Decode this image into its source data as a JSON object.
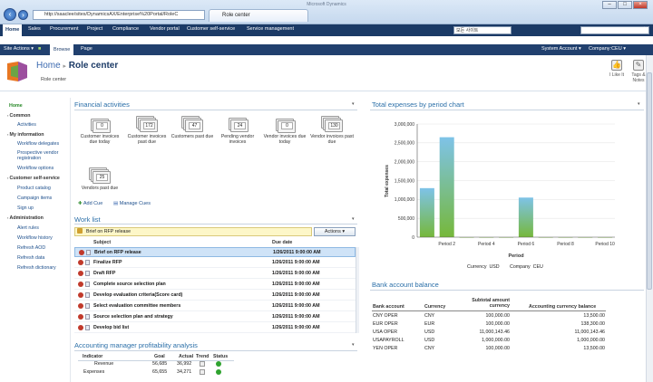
{
  "browser": {
    "window_title": "Microsoft Dynamics",
    "address": "http://saaclee/sites/DynamicsAX/Enterprise%20Portal/RoleC",
    "tab_title": "Role center"
  },
  "top_nav": {
    "items": [
      "Home",
      "Sales",
      "Procurement",
      "Project",
      "Compliance",
      "Vendor portal",
      "Customer self-service",
      "Service management"
    ],
    "search_scope": "모든 사이트"
  },
  "ribbon": {
    "site_actions": "Site Actions",
    "tabs": [
      "Browse",
      "Page"
    ],
    "account": "System Account",
    "company": "Company:CEU"
  },
  "header": {
    "home": "Home",
    "separator": "▸",
    "title": "Role center",
    "subtitle": "Role center",
    "like_label": "I Like It",
    "tags_label": "Tags & Notes"
  },
  "left_nav": {
    "home": "Home",
    "sections": [
      {
        "title": "Common",
        "items": [
          "Activities"
        ]
      },
      {
        "title": "My information",
        "items": [
          "Workflow delegates",
          "Prospective vendor registration",
          "Workflow options"
        ]
      },
      {
        "title": "Customer self-service",
        "items": [
          "Product catalog",
          "Campaign items",
          "Sign up"
        ]
      },
      {
        "title": "Administration",
        "items": [
          "Alert rules",
          "Workflow history",
          "Refresh AOD",
          "Refresh data",
          "Refresh dictionary"
        ]
      }
    ]
  },
  "financial_activities": {
    "title": "Financial activities",
    "cues": [
      {
        "label": "Customer invoices due today",
        "count": "0"
      },
      {
        "label": "Customer invoices past due",
        "count": "172"
      },
      {
        "label": "Customers past due",
        "count": "47"
      },
      {
        "label": "Pending vendor invoices",
        "count": "24"
      },
      {
        "label": "Vendor invoices due today",
        "count": "0"
      },
      {
        "label": "Vendor invoices past due",
        "count": "130"
      },
      {
        "label": "Vendors past due",
        "count": "25"
      }
    ],
    "add_cue": "Add Cue",
    "manage_cues": "Manage Cues"
  },
  "work_list": {
    "title": "Work list",
    "filter": "Brief on RFP release",
    "actions_label": "Actions",
    "columns": [
      "Subject",
      "Due date"
    ],
    "rows": [
      {
        "subject": "Brief on RFP release",
        "due": "1/26/2011 9:00:00 AM",
        "selected": true
      },
      {
        "subject": "Finalize RFP",
        "due": "1/26/2011 9:00:00 AM"
      },
      {
        "subject": "Draft RFP",
        "due": "1/26/2011 9:00:00 AM"
      },
      {
        "subject": "Complete source selection plan",
        "due": "1/26/2011 9:00:00 AM"
      },
      {
        "subject": "Develop evaluation criteria(Score card)",
        "due": "1/26/2011 9:00:00 AM"
      },
      {
        "subject": "Select evaluation committee members",
        "due": "1/26/2011 9:00:00 AM"
      },
      {
        "subject": "Source selection plan and strategy",
        "due": "1/26/2011 9:00:00 AM"
      },
      {
        "subject": "Develop bid list",
        "due": "1/26/2011 9:00:00 AM"
      }
    ]
  },
  "profitability": {
    "title": "Accounting manager profitability analysis",
    "columns": [
      "Indicator",
      "Goal",
      "Actual",
      "Trend",
      "Status"
    ],
    "rows": [
      {
        "indicator": "Revenue",
        "goal": "56,685",
        "actual": "36,992"
      },
      {
        "indicator": "Expenses",
        "goal": "65,655",
        "actual": "34,271"
      }
    ]
  },
  "expenses_chart": {
    "panel_title": "Total expenses by period chart",
    "currency_label": "Currency",
    "currency": "USD",
    "company_label": "Company",
    "company": "CEU"
  },
  "chart_data": {
    "type": "bar",
    "categories": [
      "Period 2",
      "Period 4",
      "Period 6",
      "Period 8",
      "Period 10"
    ],
    "x_positions": [
      1,
      2,
      3,
      4,
      5,
      6,
      7,
      8,
      9,
      10
    ],
    "values_by_period": [
      1300000,
      2650000,
      0,
      0,
      0,
      1050000,
      0,
      0,
      0,
      0
    ],
    "ylabel": "Total expenses",
    "xlabel": "Period",
    "ylim": [
      0,
      3000000
    ],
    "yticks": [
      "3,000,000",
      "2,500,000",
      "2,000,000",
      "1,500,000",
      "1,000,000",
      "500,000",
      "0"
    ]
  },
  "bank_balance": {
    "title": "Bank account balance",
    "columns": [
      "Bank account",
      "Currency",
      "Subtotal amount currency",
      "Accounting currency balance"
    ],
    "rows": [
      {
        "account": "CNY OPER",
        "currency": "CNY",
        "subtotal": "100,000.00",
        "balance": "13,500.00"
      },
      {
        "account": "EUR OPER",
        "currency": "EUR",
        "subtotal": "100,000.00",
        "balance": "138,300.00"
      },
      {
        "account": "USA OPER",
        "currency": "USD",
        "subtotal": "11,000,143.46",
        "balance": "11,000,143.46"
      },
      {
        "account": "USAPAYROLL",
        "currency": "USD",
        "subtotal": "1,000,000.00",
        "balance": "1,000,000.00"
      },
      {
        "account": "YEN OPER",
        "currency": "CNY",
        "subtotal": "100,000.00",
        "balance": "13,500.00"
      }
    ]
  },
  "colors": {
    "nav_dark": "#1b3a66",
    "accent_green": "#2a8a2a",
    "bar_top": "#7ec3e8",
    "bar_bottom": "#76b83a"
  }
}
